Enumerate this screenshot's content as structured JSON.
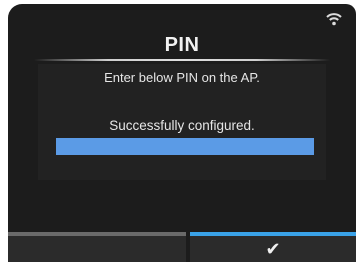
{
  "screen": {
    "title": "PIN",
    "instruction": "Enter below PIN on the AP.",
    "status": "Successfully configured.",
    "progress": 1.0
  },
  "status_bar": {
    "icons": [
      "wifi-icon"
    ]
  },
  "softkeys": {
    "left": {
      "label": ""
    },
    "right": {
      "label": "✔",
      "icon": "check-icon"
    }
  },
  "colors": {
    "background": "#1c1c1c",
    "progress": "#5b9be6",
    "accent": "#3aa2e8"
  }
}
